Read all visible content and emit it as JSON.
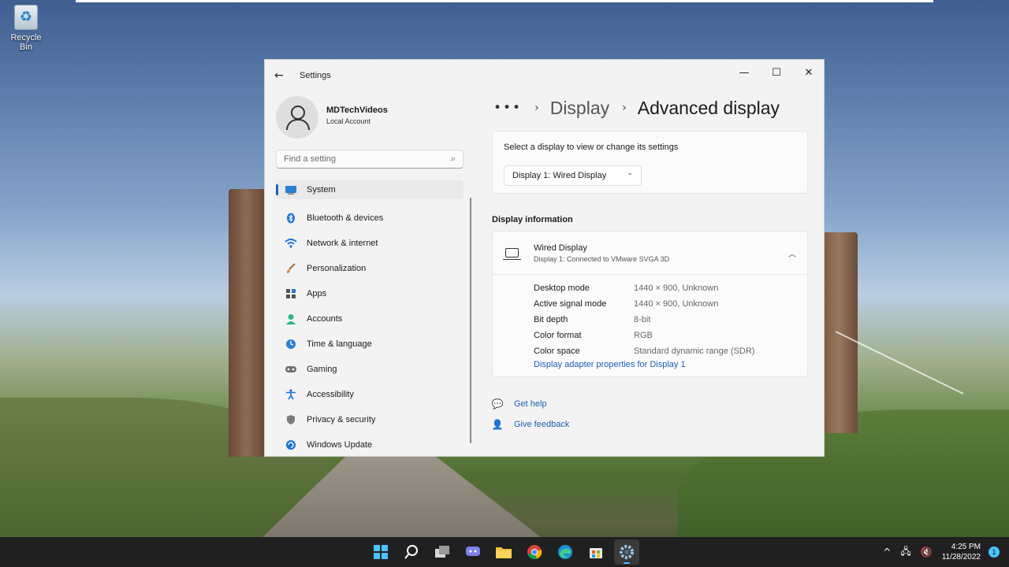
{
  "desktop": {
    "recycle_bin_label": "Recycle Bin"
  },
  "window": {
    "app_title": "Settings",
    "back_icon": "back-arrow-icon",
    "controls": [
      "minimize",
      "maximize",
      "close"
    ]
  },
  "account": {
    "name": "MDTechVideos",
    "type": "Local Account"
  },
  "search": {
    "placeholder": "Find a setting"
  },
  "sidebar": {
    "items": [
      {
        "label": "System",
        "icon": "system-icon",
        "active": true
      },
      {
        "label": "Bluetooth & devices",
        "icon": "bluetooth-icon"
      },
      {
        "label": "Network & internet",
        "icon": "wifi-icon"
      },
      {
        "label": "Personalization",
        "icon": "brush-icon"
      },
      {
        "label": "Apps",
        "icon": "apps-icon"
      },
      {
        "label": "Accounts",
        "icon": "person-icon"
      },
      {
        "label": "Time & language",
        "icon": "globe-clock-icon"
      },
      {
        "label": "Gaming",
        "icon": "gamepad-icon"
      },
      {
        "label": "Accessibility",
        "icon": "accessibility-icon"
      },
      {
        "label": "Privacy & security",
        "icon": "shield-icon"
      },
      {
        "label": "Windows Update",
        "icon": "update-icon"
      }
    ]
  },
  "breadcrumb": {
    "more": "•••",
    "parent": "Display",
    "current": "Advanced display"
  },
  "display_select": {
    "prompt": "Select a display to view or change its settings",
    "selected": "Display 1: Wired Display"
  },
  "display_info": {
    "section_title": "Display information",
    "name": "Wired Display",
    "subtitle": "Display 1: Connected to VMware SVGA 3D",
    "specs": [
      {
        "label": "Desktop mode",
        "value": "1440 × 900, Unknown"
      },
      {
        "label": "Active signal mode",
        "value": "1440 × 900, Unknown"
      },
      {
        "label": "Bit depth",
        "value": "8-bit"
      },
      {
        "label": "Color format",
        "value": "RGB"
      },
      {
        "label": "Color space",
        "value": "Standard dynamic range (SDR)"
      }
    ],
    "adapter_link": "Display adapter properties for Display 1"
  },
  "help": {
    "get_help": "Get help",
    "give_feedback": "Give feedback"
  },
  "taskbar": {
    "apps": [
      "start-icon",
      "search-icon",
      "task-view-icon",
      "chat-icon",
      "file-explorer-icon",
      "chrome-icon",
      "edge-icon",
      "store-icon",
      "settings-icon"
    ],
    "time": "4:25 PM",
    "date": "11/28/2022",
    "notification_count": "1"
  },
  "colors": {
    "accent": "#1a63b8",
    "link": "#1a5fb4",
    "taskbar_accent": "#4cc2ff"
  }
}
